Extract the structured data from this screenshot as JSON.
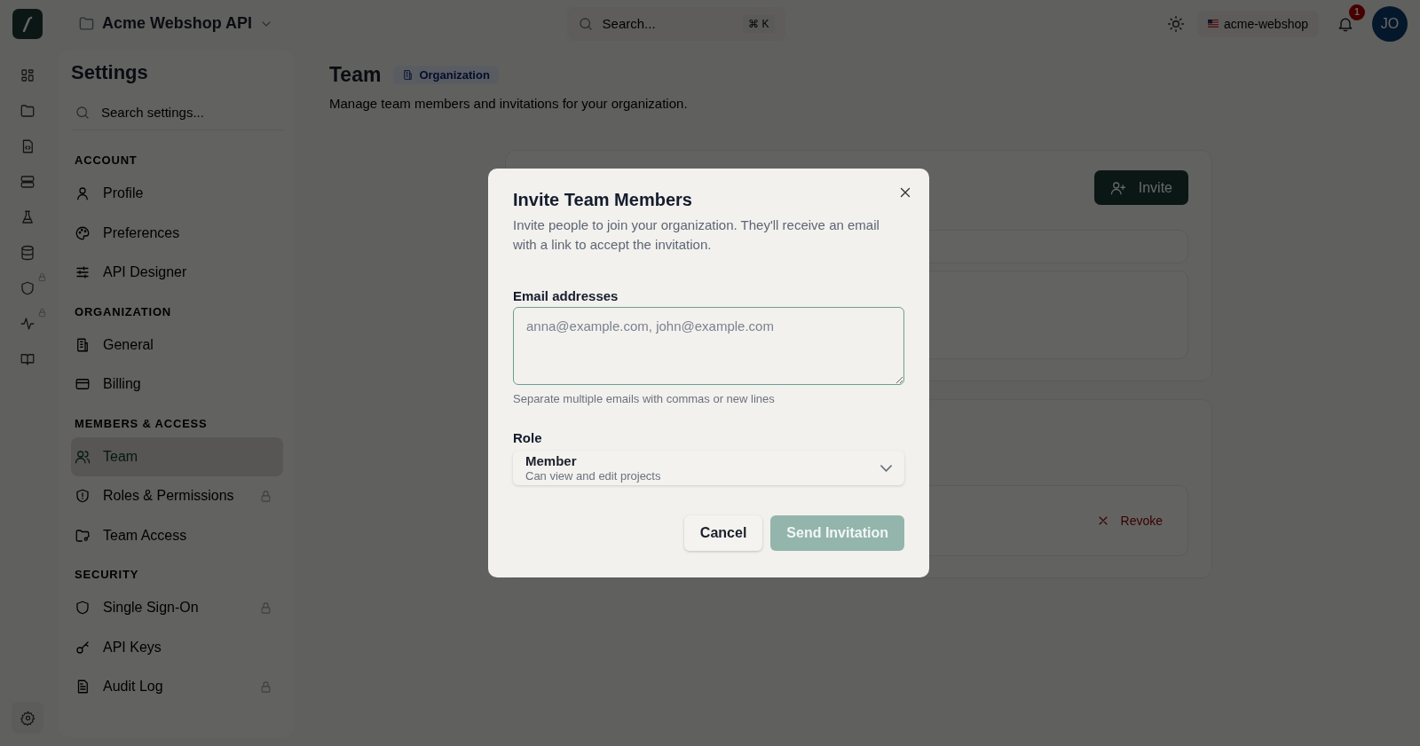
{
  "topbar": {
    "project": "Acme Webshop API",
    "search_placeholder": "Search...",
    "shortcut": "⌘ K",
    "workspace": "acme-webshop",
    "notification_count": "1",
    "avatar": "JO"
  },
  "rail": [
    {
      "kind": "grid",
      "locked": false
    },
    {
      "kind": "folder",
      "locked": false
    },
    {
      "kind": "code-file",
      "locked": false
    },
    {
      "kind": "server",
      "locked": false
    },
    {
      "kind": "flask",
      "locked": false
    },
    {
      "kind": "database",
      "locked": false
    },
    {
      "kind": "shield",
      "locked": true
    },
    {
      "kind": "activity",
      "locked": true
    },
    {
      "kind": "book",
      "locked": false
    }
  ],
  "settings": {
    "title": "Settings",
    "search_placeholder": "Search settings...",
    "sections": [
      {
        "heading": "ACCOUNT",
        "items": [
          {
            "label": "Profile",
            "kind": "user",
            "selected": false,
            "locked": false
          },
          {
            "label": "Preferences",
            "kind": "palette",
            "selected": false,
            "locked": false
          },
          {
            "label": "API Designer",
            "kind": "sliders",
            "selected": false,
            "locked": false
          }
        ]
      },
      {
        "heading": "ORGANIZATION",
        "items": [
          {
            "label": "General",
            "kind": "building",
            "selected": false,
            "locked": false
          },
          {
            "label": "Billing",
            "kind": "card",
            "selected": false,
            "locked": false
          }
        ]
      },
      {
        "heading": "MEMBERS & ACCESS",
        "items": [
          {
            "label": "Team",
            "kind": "users",
            "selected": true,
            "locked": false
          },
          {
            "label": "Roles & Permissions",
            "kind": "shield-alert",
            "selected": false,
            "locked": true
          },
          {
            "label": "Team Access",
            "kind": "folder-key",
            "selected": false,
            "locked": false
          }
        ]
      },
      {
        "heading": "SECURITY",
        "items": [
          {
            "label": "Single Sign-On",
            "kind": "shield",
            "selected": false,
            "locked": true
          },
          {
            "label": "API Keys",
            "kind": "key",
            "selected": false,
            "locked": false
          },
          {
            "label": "Audit Log",
            "kind": "file",
            "selected": false,
            "locked": true
          }
        ]
      }
    ]
  },
  "page": {
    "title": "Team",
    "badge": "Organization",
    "description": "Manage team members and invitations for your organization.",
    "invite_button": "Invite",
    "revoke_button": "Revoke"
  },
  "modal": {
    "title": "Invite Team Members",
    "description": "Invite people to join your organization. They'll receive an email with a link to accept the invitation.",
    "email_label": "Email addresses",
    "email_placeholder": "anna@example.com, john@example.com",
    "hint": "Separate multiple emails with commas or new lines",
    "role_label": "Role",
    "role": "Member",
    "role_description": "Can view and edit projects",
    "cancel": "Cancel",
    "submit": "Send Invitation",
    "submit_disabled": true
  }
}
